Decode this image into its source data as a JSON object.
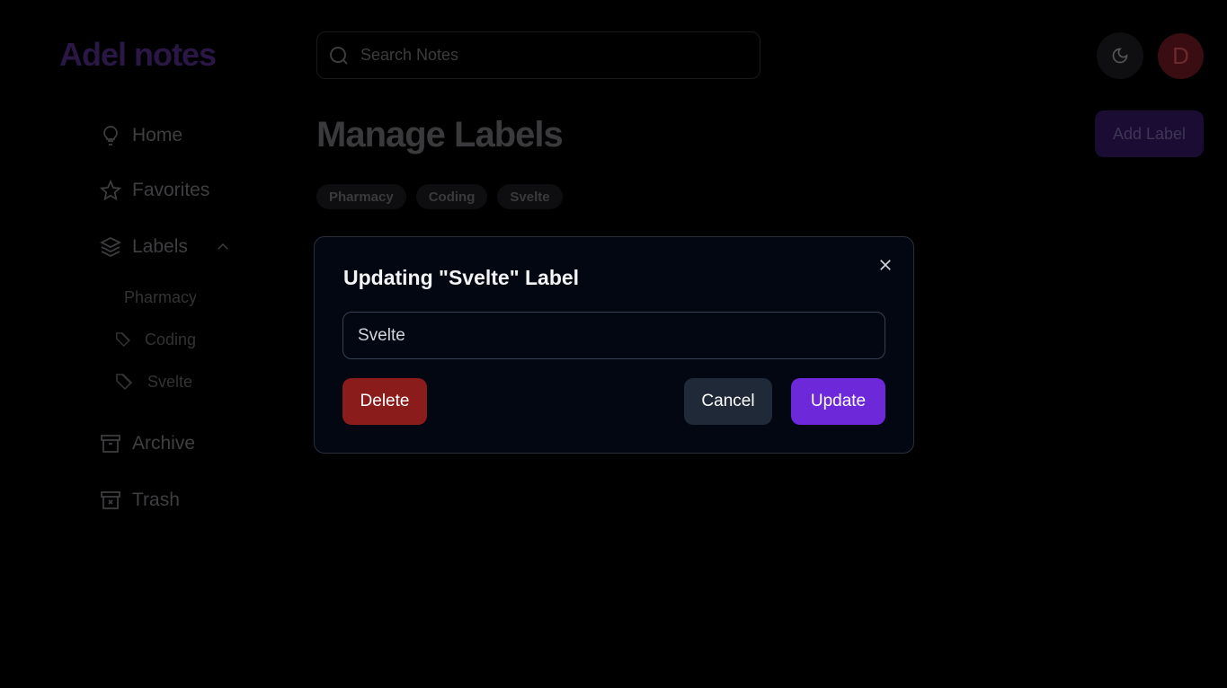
{
  "app": {
    "logo": "Adel notes",
    "avatar_initial": "D"
  },
  "search": {
    "placeholder": "Search Notes",
    "value": ""
  },
  "sidebar": {
    "items": [
      {
        "label": "Home",
        "icon": "lightbulb-icon"
      },
      {
        "label": "Favorites",
        "icon": "star-icon"
      },
      {
        "label": "Labels",
        "icon": "layers-icon"
      },
      {
        "label": "Archive",
        "icon": "archive-icon"
      },
      {
        "label": "Trash",
        "icon": "trash-icon"
      }
    ],
    "labels": [
      "Pharmacy",
      "Coding",
      "Svelte"
    ]
  },
  "main": {
    "title": "Manage Labels",
    "add_label": "Add Label",
    "chips": [
      "Pharmacy",
      "Coding",
      "Svelte"
    ]
  },
  "modal": {
    "title": "Updating \"Svelte\" Label",
    "input_value": "Svelte",
    "delete": "Delete",
    "cancel": "Cancel",
    "update": "Update"
  },
  "colors": {
    "delete": "#8b1c1c",
    "cancel": "#1f2937",
    "update": "#6d28d9"
  }
}
